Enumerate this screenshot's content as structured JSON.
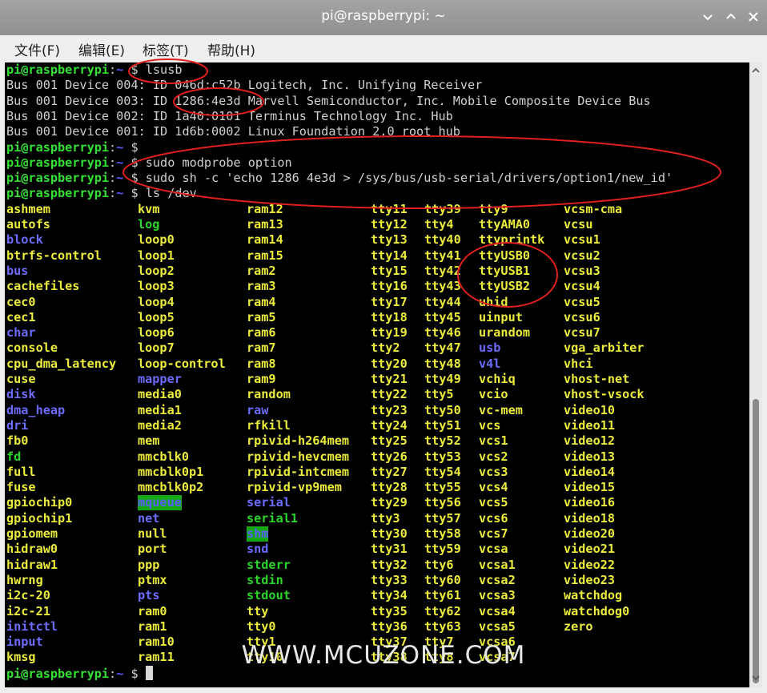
{
  "window": {
    "title": "pi@raspberrypi: ~",
    "minimize_label": "⌄",
    "maximize_label": "⌃",
    "close_label": "✕"
  },
  "menu": {
    "items": [
      {
        "label": "文件(F)"
      },
      {
        "label": "编辑(E)"
      },
      {
        "label": "标签(T)"
      },
      {
        "label": "帮助(H)"
      }
    ]
  },
  "prompt": {
    "user": "pi@raspberrypi",
    "colon": ":",
    "path": "~",
    "dollar": " $"
  },
  "terminal": {
    "lines": [
      {
        "type": "prompt",
        "cmd": " lsusb"
      },
      {
        "type": "out",
        "text": "Bus 001 Device 004: ID 046d:c52b Logitech, Inc. Unifying Receiver"
      },
      {
        "type": "out",
        "text": "Bus 001 Device 003: ID 1286:4e3d Marvell Semiconductor, Inc. Mobile Composite Device Bus"
      },
      {
        "type": "out",
        "text": "Bus 001 Device 002: ID 1a40:0101 Terminus Technology Inc. Hub"
      },
      {
        "type": "out",
        "text": "Bus 001 Device 001: ID 1d6b:0002 Linux Foundation 2.0 root hub"
      },
      {
        "type": "prompt",
        "cmd": ""
      },
      {
        "type": "prompt",
        "cmd": " sudo modprobe option"
      },
      {
        "type": "prompt",
        "cmd": " sudo sh -c 'echo 1286 4e3d > /sys/bus/usb-serial/drivers/option1/new_id'"
      },
      {
        "type": "prompt",
        "cmd": " ls /dev"
      }
    ],
    "listing_columns": [
      [
        {
          "t": "ashmem",
          "c": "y"
        },
        {
          "t": "autofs",
          "c": "y"
        },
        {
          "t": "block",
          "c": "b"
        },
        {
          "t": "btrfs-control",
          "c": "y"
        },
        {
          "t": "bus",
          "c": "b"
        },
        {
          "t": "cachefiles",
          "c": "y"
        },
        {
          "t": "cec0",
          "c": "y"
        },
        {
          "t": "cec1",
          "c": "y"
        },
        {
          "t": "char",
          "c": "b"
        },
        {
          "t": "console",
          "c": "y"
        },
        {
          "t": "cpu_dma_latency",
          "c": "y"
        },
        {
          "t": "cuse",
          "c": "y"
        },
        {
          "t": "disk",
          "c": "b"
        },
        {
          "t": "dma_heap",
          "c": "b"
        },
        {
          "t": "dri",
          "c": "b"
        },
        {
          "t": "fb0",
          "c": "y"
        },
        {
          "t": "fd",
          "c": "g"
        },
        {
          "t": "full",
          "c": "y"
        },
        {
          "t": "fuse",
          "c": "y"
        },
        {
          "t": "gpiochip0",
          "c": "y"
        },
        {
          "t": "gpiochip1",
          "c": "y"
        },
        {
          "t": "gpiomem",
          "c": "y"
        },
        {
          "t": "hidraw0",
          "c": "y"
        },
        {
          "t": "hidraw1",
          "c": "y"
        },
        {
          "t": "hwrng",
          "c": "y"
        },
        {
          "t": "i2c-20",
          "c": "y"
        },
        {
          "t": "i2c-21",
          "c": "y"
        },
        {
          "t": "initctl",
          "c": "b"
        },
        {
          "t": "input",
          "c": "b"
        },
        {
          "t": "kmsg",
          "c": "y"
        }
      ],
      [
        {
          "t": "kvm",
          "c": "y"
        },
        {
          "t": "log",
          "c": "g"
        },
        {
          "t": "loop0",
          "c": "y"
        },
        {
          "t": "loop1",
          "c": "y"
        },
        {
          "t": "loop2",
          "c": "y"
        },
        {
          "t": "loop3",
          "c": "y"
        },
        {
          "t": "loop4",
          "c": "y"
        },
        {
          "t": "loop5",
          "c": "y"
        },
        {
          "t": "loop6",
          "c": "y"
        },
        {
          "t": "loop7",
          "c": "y"
        },
        {
          "t": "loop-control",
          "c": "y"
        },
        {
          "t": "mapper",
          "c": "b"
        },
        {
          "t": "media0",
          "c": "y"
        },
        {
          "t": "media1",
          "c": "y"
        },
        {
          "t": "media2",
          "c": "y"
        },
        {
          "t": "mem",
          "c": "y"
        },
        {
          "t": "mmcblk0",
          "c": "y"
        },
        {
          "t": "mmcblk0p1",
          "c": "y"
        },
        {
          "t": "mmcblk0p2",
          "c": "y"
        },
        {
          "t": "mqueue",
          "c": "bgg"
        },
        {
          "t": "net",
          "c": "b"
        },
        {
          "t": "null",
          "c": "y"
        },
        {
          "t": "port",
          "c": "y"
        },
        {
          "t": "ppp",
          "c": "y"
        },
        {
          "t": "ptmx",
          "c": "y"
        },
        {
          "t": "pts",
          "c": "b"
        },
        {
          "t": "ram0",
          "c": "y"
        },
        {
          "t": "ram1",
          "c": "y"
        },
        {
          "t": "ram10",
          "c": "y"
        },
        {
          "t": "ram11",
          "c": "y"
        }
      ],
      [
        {
          "t": "ram12",
          "c": "y"
        },
        {
          "t": "ram13",
          "c": "y"
        },
        {
          "t": "ram14",
          "c": "y"
        },
        {
          "t": "ram15",
          "c": "y"
        },
        {
          "t": "ram2",
          "c": "y"
        },
        {
          "t": "ram3",
          "c": "y"
        },
        {
          "t": "ram4",
          "c": "y"
        },
        {
          "t": "ram5",
          "c": "y"
        },
        {
          "t": "ram6",
          "c": "y"
        },
        {
          "t": "ram7",
          "c": "y"
        },
        {
          "t": "ram8",
          "c": "y"
        },
        {
          "t": "ram9",
          "c": "y"
        },
        {
          "t": "random",
          "c": "y"
        },
        {
          "t": "raw",
          "c": "b"
        },
        {
          "t": "rfkill",
          "c": "y"
        },
        {
          "t": "rpivid-h264mem",
          "c": "y"
        },
        {
          "t": "rpivid-hevcmem",
          "c": "y"
        },
        {
          "t": "rpivid-intcmem",
          "c": "y"
        },
        {
          "t": "rpivid-vp9mem",
          "c": "y"
        },
        {
          "t": "serial",
          "c": "b"
        },
        {
          "t": "serial1",
          "c": "g"
        },
        {
          "t": "shm",
          "c": "bgg"
        },
        {
          "t": "snd",
          "c": "b"
        },
        {
          "t": "stderr",
          "c": "g"
        },
        {
          "t": "stdin",
          "c": "g"
        },
        {
          "t": "stdout",
          "c": "g"
        },
        {
          "t": "tty",
          "c": "y"
        },
        {
          "t": "tty0",
          "c": "y"
        },
        {
          "t": "tty1",
          "c": "y"
        },
        {
          "t": "tty10",
          "c": "y"
        }
      ],
      [
        {
          "t": "tty11",
          "c": "y"
        },
        {
          "t": "tty12",
          "c": "y"
        },
        {
          "t": "tty13",
          "c": "y"
        },
        {
          "t": "tty14",
          "c": "y"
        },
        {
          "t": "tty15",
          "c": "y"
        },
        {
          "t": "tty16",
          "c": "y"
        },
        {
          "t": "tty17",
          "c": "y"
        },
        {
          "t": "tty18",
          "c": "y"
        },
        {
          "t": "tty19",
          "c": "y"
        },
        {
          "t": "tty2",
          "c": "y"
        },
        {
          "t": "tty20",
          "c": "y"
        },
        {
          "t": "tty21",
          "c": "y"
        },
        {
          "t": "tty22",
          "c": "y"
        },
        {
          "t": "tty23",
          "c": "y"
        },
        {
          "t": "tty24",
          "c": "y"
        },
        {
          "t": "tty25",
          "c": "y"
        },
        {
          "t": "tty26",
          "c": "y"
        },
        {
          "t": "tty27",
          "c": "y"
        },
        {
          "t": "tty28",
          "c": "y"
        },
        {
          "t": "tty29",
          "c": "y"
        },
        {
          "t": "tty3",
          "c": "y"
        },
        {
          "t": "tty30",
          "c": "y"
        },
        {
          "t": "tty31",
          "c": "y"
        },
        {
          "t": "tty32",
          "c": "y"
        },
        {
          "t": "tty33",
          "c": "y"
        },
        {
          "t": "tty34",
          "c": "y"
        },
        {
          "t": "tty35",
          "c": "y"
        },
        {
          "t": "tty36",
          "c": "y"
        },
        {
          "t": "tty37",
          "c": "y"
        },
        {
          "t": "tty38",
          "c": "y"
        }
      ],
      [
        {
          "t": "tty39",
          "c": "y"
        },
        {
          "t": "tty4",
          "c": "y"
        },
        {
          "t": "tty40",
          "c": "y"
        },
        {
          "t": "tty41",
          "c": "y"
        },
        {
          "t": "tty42",
          "c": "y"
        },
        {
          "t": "tty43",
          "c": "y"
        },
        {
          "t": "tty44",
          "c": "y"
        },
        {
          "t": "tty45",
          "c": "y"
        },
        {
          "t": "tty46",
          "c": "y"
        },
        {
          "t": "tty47",
          "c": "y"
        },
        {
          "t": "tty48",
          "c": "y"
        },
        {
          "t": "tty49",
          "c": "y"
        },
        {
          "t": "tty5",
          "c": "y"
        },
        {
          "t": "tty50",
          "c": "y"
        },
        {
          "t": "tty51",
          "c": "y"
        },
        {
          "t": "tty52",
          "c": "y"
        },
        {
          "t": "tty53",
          "c": "y"
        },
        {
          "t": "tty54",
          "c": "y"
        },
        {
          "t": "tty55",
          "c": "y"
        },
        {
          "t": "tty56",
          "c": "y"
        },
        {
          "t": "tty57",
          "c": "y"
        },
        {
          "t": "tty58",
          "c": "y"
        },
        {
          "t": "tty59",
          "c": "y"
        },
        {
          "t": "tty6",
          "c": "y"
        },
        {
          "t": "tty60",
          "c": "y"
        },
        {
          "t": "tty61",
          "c": "y"
        },
        {
          "t": "tty62",
          "c": "y"
        },
        {
          "t": "tty63",
          "c": "y"
        },
        {
          "t": "tty7",
          "c": "y"
        },
        {
          "t": "tty8",
          "c": "y"
        }
      ],
      [
        {
          "t": "tty9",
          "c": "y"
        },
        {
          "t": "ttyAMA0",
          "c": "y"
        },
        {
          "t": "ttyprintk",
          "c": "y"
        },
        {
          "t": "ttyUSB0",
          "c": "y"
        },
        {
          "t": "ttyUSB1",
          "c": "y"
        },
        {
          "t": "ttyUSB2",
          "c": "y"
        },
        {
          "t": "uhid",
          "c": "y"
        },
        {
          "t": "uinput",
          "c": "y"
        },
        {
          "t": "urandom",
          "c": "y"
        },
        {
          "t": "usb",
          "c": "b"
        },
        {
          "t": "v4l",
          "c": "b"
        },
        {
          "t": "vchiq",
          "c": "y"
        },
        {
          "t": "vcio",
          "c": "y"
        },
        {
          "t": "vc-mem",
          "c": "y"
        },
        {
          "t": "vcs",
          "c": "y"
        },
        {
          "t": "vcs1",
          "c": "y"
        },
        {
          "t": "vcs2",
          "c": "y"
        },
        {
          "t": "vcs3",
          "c": "y"
        },
        {
          "t": "vcs4",
          "c": "y"
        },
        {
          "t": "vcs5",
          "c": "y"
        },
        {
          "t": "vcs6",
          "c": "y"
        },
        {
          "t": "vcs7",
          "c": "y"
        },
        {
          "t": "vcsa",
          "c": "y"
        },
        {
          "t": "vcsa1",
          "c": "y"
        },
        {
          "t": "vcsa2",
          "c": "y"
        },
        {
          "t": "vcsa3",
          "c": "y"
        },
        {
          "t": "vcsa4",
          "c": "y"
        },
        {
          "t": "vcsa5",
          "c": "y"
        },
        {
          "t": "vcsa6",
          "c": "y"
        },
        {
          "t": "vcsa7",
          "c": "y"
        }
      ],
      [
        {
          "t": "vcsm-cma",
          "c": "y"
        },
        {
          "t": "vcsu",
          "c": "y"
        },
        {
          "t": "vcsu1",
          "c": "y"
        },
        {
          "t": "vcsu2",
          "c": "y"
        },
        {
          "t": "vcsu3",
          "c": "y"
        },
        {
          "t": "vcsu4",
          "c": "y"
        },
        {
          "t": "vcsu5",
          "c": "y"
        },
        {
          "t": "vcsu6",
          "c": "y"
        },
        {
          "t": "vcsu7",
          "c": "y"
        },
        {
          "t": "vga_arbiter",
          "c": "y"
        },
        {
          "t": "vhci",
          "c": "y"
        },
        {
          "t": "vhost-net",
          "c": "y"
        },
        {
          "t": "vhost-vsock",
          "c": "y"
        },
        {
          "t": "video10",
          "c": "y"
        },
        {
          "t": "video11",
          "c": "y"
        },
        {
          "t": "video12",
          "c": "y"
        },
        {
          "t": "video13",
          "c": "y"
        },
        {
          "t": "video14",
          "c": "y"
        },
        {
          "t": "video15",
          "c": "y"
        },
        {
          "t": "video16",
          "c": "y"
        },
        {
          "t": "video18",
          "c": "y"
        },
        {
          "t": "video20",
          "c": "y"
        },
        {
          "t": "video21",
          "c": "y"
        },
        {
          "t": "video22",
          "c": "y"
        },
        {
          "t": "video23",
          "c": "y"
        },
        {
          "t": "watchdog",
          "c": "y"
        },
        {
          "t": "watchdog0",
          "c": "y"
        },
        {
          "t": "zero",
          "c": "y"
        }
      ]
    ],
    "final_prompt_cmd": " "
  },
  "colors": {
    "prompt_user": "#33e033",
    "prompt_path": "#5c5cff",
    "file_yellow": "#ecec3c",
    "dir_blue": "#6c6cff",
    "link_green": "#2ad62a",
    "annotation_red": "#e0201e"
  },
  "watermark": "WWW.MCUZONE.COM"
}
